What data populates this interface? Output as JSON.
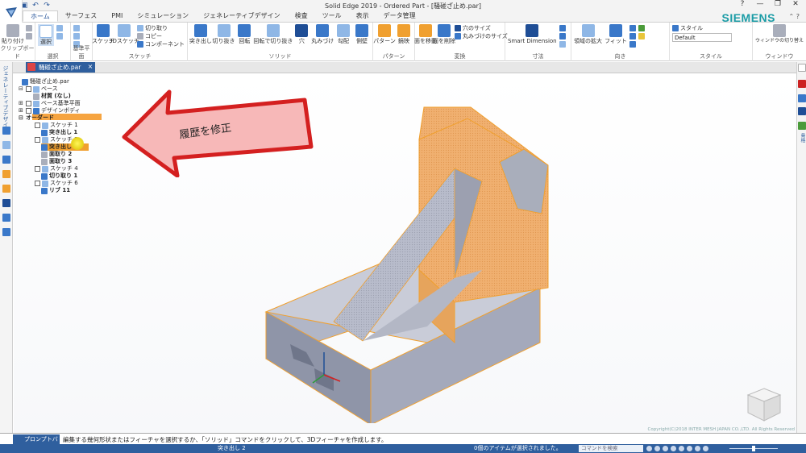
{
  "window": {
    "title": "Solid Edge 2019 - Ordered Part - [騒碰ざ止め.par]",
    "controls": [
      "?",
      "—",
      "❐",
      "✕"
    ],
    "brand": "SIEMENS"
  },
  "quick_access": [
    "save-icon",
    "undo-icon",
    "redo-icon"
  ],
  "ribbon_tabs": [
    "ホーム",
    "サーフェス",
    "PMI",
    "シミュレーション",
    "ジェネレーティブデザイン",
    "検査",
    "ツール",
    "表示",
    "データ管理"
  ],
  "active_tab": "ホーム",
  "ribbon": {
    "clipboard": {
      "label": "クリップボード",
      "paste": "貼り付け"
    },
    "select": {
      "label": "選択",
      "select_btn": "選択"
    },
    "plane": {
      "label": "基準平面"
    },
    "sketch": {
      "label": "スケッチ",
      "sketch_btn": "スケッチ",
      "sketch3d_btn": "3Dスケッチ",
      "cut": "切り取り",
      "copy": "コピー",
      "component": "コンポーネント"
    },
    "solid": {
      "label": "ソリッド",
      "buttons": [
        "突き出し",
        "切り抜き",
        "回転",
        "回転で切り抜き",
        "穴",
        "丸みづけ",
        "勾配",
        "側壁"
      ]
    },
    "pattern": {
      "label": "パターン",
      "buttons": [
        "パターン",
        "鏡映"
      ]
    },
    "transform": {
      "label": "変換",
      "buttons": [
        "面を移動",
        "面を削除"
      ],
      "small": [
        "穴のサイズ",
        "丸みづけのサイズ"
      ]
    },
    "dimension": {
      "label": "寸法",
      "smart_dimension": "Smart Dimension"
    },
    "orient": {
      "label": "向き",
      "buttons": [
        "領域の拡大",
        "フィット"
      ]
    },
    "style": {
      "label": "スタイル",
      "style_btn": "スタイル",
      "default_value": "Default"
    },
    "window_group": {
      "label": "ウィンドウ",
      "btn": "ウィンドウの切り替え"
    }
  },
  "doc_tab": {
    "name": "騒碰ざ止め.par",
    "close": "×"
  },
  "left_strip": {
    "label": "ジェネレーティブデザイン"
  },
  "right_strip": {
    "label": "骨格"
  },
  "tree": {
    "root": "騒碰ざ止め.par",
    "base": "ベース",
    "material": "材質 (なし)",
    "base_planes": "ベース基準平面",
    "design_body": "デザインボディ",
    "ordered": "オーダード",
    "items": [
      {
        "name": "スケッチ 1",
        "type": "sketch"
      },
      {
        "name": "突き出し 1",
        "type": "feature"
      },
      {
        "name": "スケッチ 2",
        "type": "sketch"
      },
      {
        "name": "突き出し 2",
        "type": "feature",
        "highlight": true
      },
      {
        "name": "面取り 2",
        "type": "feature"
      },
      {
        "name": "面取り 3",
        "type": "feature"
      },
      {
        "name": "スケッチ 4",
        "type": "sketch"
      },
      {
        "name": "切り取り 1",
        "type": "feature"
      },
      {
        "name": "スケッチ 6",
        "type": "sketch"
      },
      {
        "name": "リブ 11",
        "type": "feature"
      }
    ]
  },
  "annotation": {
    "text": "履歴を修正",
    "colors": {
      "fill": "#f5b4b4",
      "stroke": "#d42020"
    }
  },
  "prompt": {
    "tag": "プロンプトバー",
    "text": "編集する幾何形状またはフィーチャを選択するか、「ソリッド」コマンドをクリックして、3Dフィーチャを作成します。",
    "copyright": "Copyright(C)2018 INTER MESH JAPAN CO.,LTD. All Rights Reserved"
  },
  "status": {
    "left": "突き出し 2",
    "middle": "0個のアイテムが選択されました。",
    "search_placeholder": "コマンドを検索"
  },
  "colors": {
    "accent": "#2f5f9e",
    "model_face": "#f0b070",
    "model_edge": "#f0a030"
  }
}
